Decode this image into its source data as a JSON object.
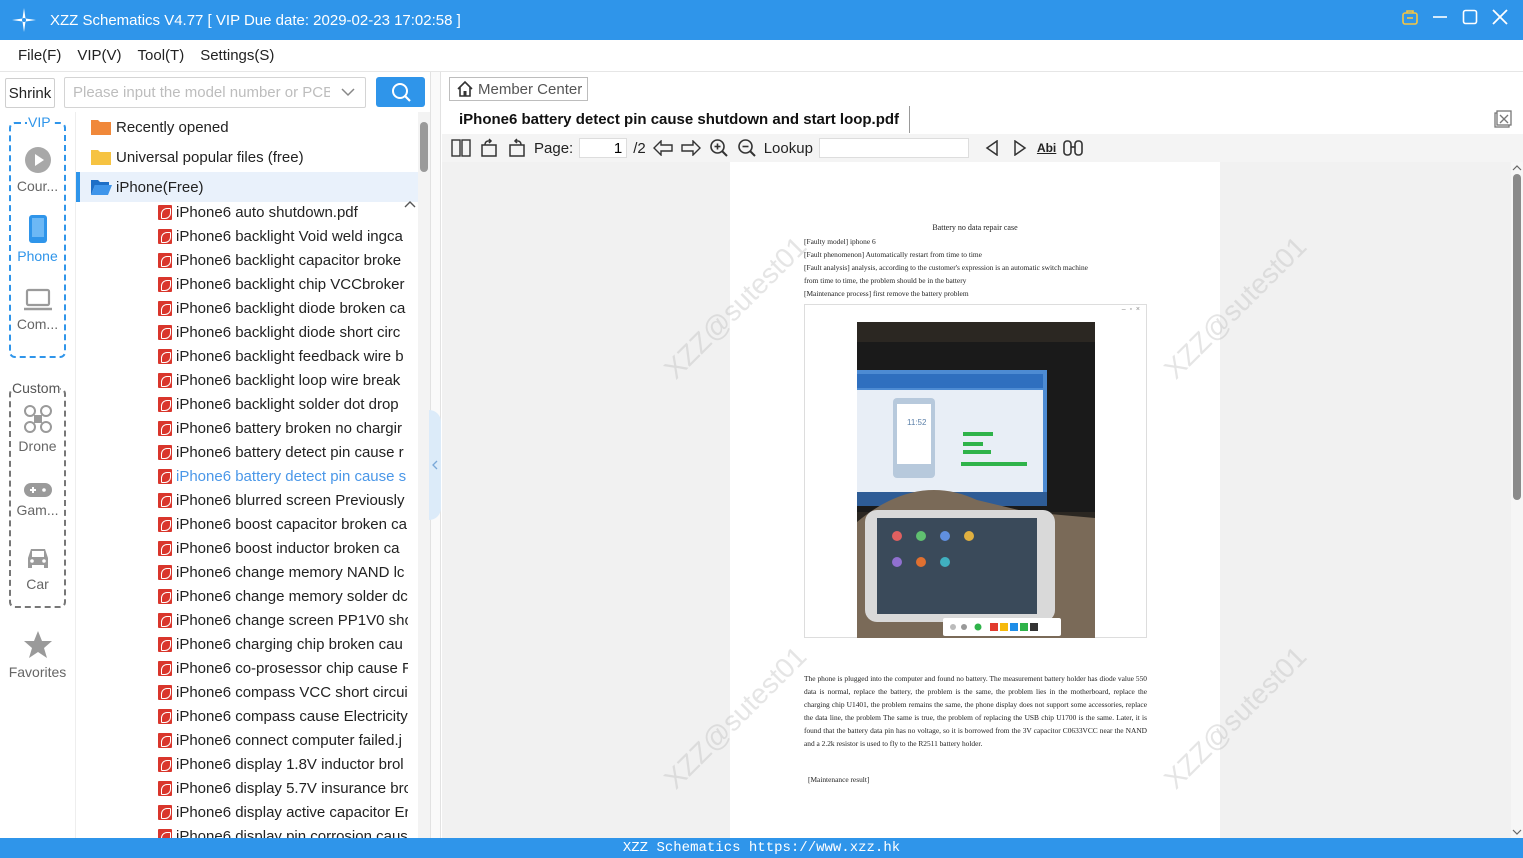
{
  "window": {
    "title": "XZZ Schematics V4.77 [ VIP Due date: 2029-02-23 17:02:58 ]"
  },
  "menu": [
    "File(F)",
    "VIP(V)",
    "Tool(T)",
    "Settings(S)"
  ],
  "search": {
    "shrink_label": "Shrink",
    "placeholder": "Please input the model number or PCB"
  },
  "categories": {
    "vip_label": "VIP",
    "custom_label": "Custom",
    "vip_items": [
      {
        "label": "Cour...",
        "icon": "play-circle-icon"
      },
      {
        "label": "Phone",
        "icon": "phone-icon"
      },
      {
        "label": "Com...",
        "icon": "laptop-icon"
      }
    ],
    "custom_items": [
      {
        "label": "Drone",
        "icon": "drone-icon"
      },
      {
        "label": "Gam...",
        "icon": "gamepad-icon"
      },
      {
        "label": "Car",
        "icon": "car-icon"
      }
    ],
    "favorites_label": "Favorites"
  },
  "tree": {
    "folders": [
      {
        "label": "Recently opened",
        "icon": "folder-icon"
      },
      {
        "label": "Universal popular files (free)",
        "icon": "folder-icon"
      },
      {
        "label": "iPhone(Free)",
        "icon": "folder-open-icon"
      }
    ],
    "files": [
      "iPhone6 auto shutdown.pdf",
      "iPhone6 backlight Void weld ingca",
      "iPhone6 backlight capacitor broke",
      "iPhone6 backlight chip VCCbroker",
      "iPhone6 backlight diode broken ca",
      "iPhone6 backlight diode short circ",
      "iPhone6 backlight feedback wire b",
      "iPhone6 backlight loop wire break",
      "iPhone6 backlight solder dot drop",
      "iPhone6 battery broken no chargir",
      "iPhone6 battery detect pin cause r",
      "iPhone6 battery detect pin cause s",
      "iPhone6 blurred screen Previously",
      "iPhone6 boost capacitor broken ca",
      "iPhone6 boost inductor broken ca",
      "iPhone6 change memory NAND lc",
      "iPhone6 change memory solder dc",
      "iPhone6 change screen PP1V0 sho",
      "iPhone6 charging chip broken cau",
      "iPhone6 co-prosessor chip cause R",
      "iPhone6 compass VCC short circuit",
      "iPhone6 compass cause Electricity",
      "iPhone6 connect computer failed.j",
      "iPhone6 display 1.8V inductor brol",
      "iPhone6 display 5.7V insurance brc",
      "iPhone6 display active capacitor Er",
      "iPhone6 display pin corrosion caus"
    ],
    "active_index": 11
  },
  "viewer": {
    "member_center": "Member Center",
    "tab_title": "iPhone6 battery detect pin cause shutdown and start loop.pdf",
    "page_label": "Page:",
    "page_current": "1",
    "page_total": "/2",
    "lookup_label": "Lookup",
    "abi_label": "Abi"
  },
  "document": {
    "title": "Battery no data repair case",
    "lines": [
      "[Faulty model] iphone 6",
      "[Fault phenomenon] Automatically restart from time to time",
      "[Fault analysis] analysis, according to the customer's expression is an automatic switch machine",
      "from time to time, the problem should be in the battery",
      "[Maintenance process] first remove the battery problem"
    ],
    "paragraph": "The phone is plugged into the computer and found no battery. The measurement battery holder has diode value 550 data is normal, replace the battery, the problem is the same, the problem lies in the motherboard, replace the charging chip U1401, the problem remains the same, the phone display does not support some accessories, replace the data line, the problem The same is true, the problem of replacing the USB chip U1700 is the same. Later, it is found that the battery data pin has no voltage, so it is borrowed from the 3V capacitor C0633VCC near the NAND and a 2.2k resistor is used to fly to the R2511 battery holder.",
    "result": "[Maintenance result]",
    "photo_time": "11:52",
    "watermark": "XZZ@sutest01"
  },
  "footer": "XZZ Schematics https://www.xzz.hk",
  "colors": {
    "accent": "#2f95ea",
    "pdf_red": "#d9362c",
    "folder_orange": "#f0883a",
    "folder_yellow": "#f6c342"
  }
}
